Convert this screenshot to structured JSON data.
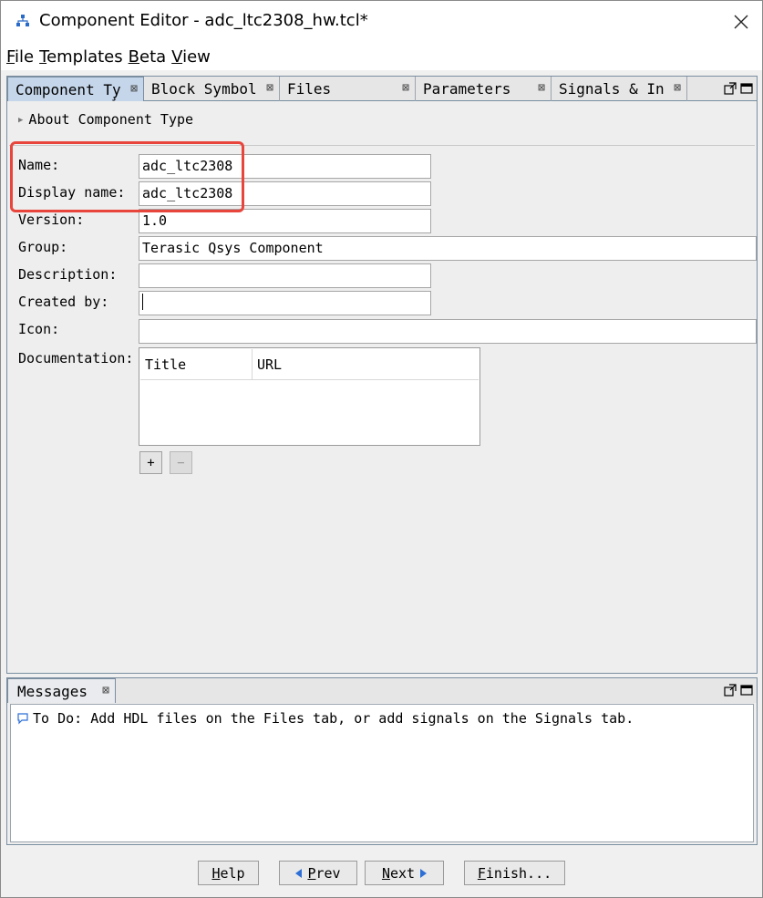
{
  "window": {
    "title": "Component Editor - adc_ltc2308_hw.tcl*",
    "icon": "component-editor-icon",
    "close_icon": "close-icon"
  },
  "menu": [
    {
      "first": "F",
      "rest": "ile"
    },
    {
      "first": "T",
      "rest": "emplates"
    },
    {
      "first": "B",
      "rest": "eta"
    },
    {
      "first": "V",
      "rest": "iew"
    }
  ],
  "tabs": [
    {
      "label": "Component Ty̧",
      "active": true
    },
    {
      "label": "Block Symbol",
      "active": false
    },
    {
      "label": "Files",
      "active": false
    },
    {
      "label": "Parameters",
      "active": false
    },
    {
      "label": "Signals & In",
      "active": false
    }
  ],
  "about": "About Component Type",
  "form": {
    "name_label": "Name:",
    "name_value": "adc_ltc2308",
    "display_label": "Display name:",
    "display_value": "adc_ltc2308",
    "version_label": "Version:",
    "version_value": "1.0",
    "group_label": "Group:",
    "group_value": "Terasic Qsys Component",
    "description_label": "Description:",
    "description_value": "",
    "created_label": "Created by:",
    "created_value": "",
    "icon_label": "Icon:",
    "icon_value": "",
    "documentation_label": "Documentation:"
  },
  "doc_table": {
    "columns": [
      "Title",
      "URL"
    ]
  },
  "doc_buttons": {
    "add": "+",
    "remove": "−"
  },
  "messages": {
    "tab_label": "Messages",
    "line": "To Do: Add HDL files on the Files tab, or add signals on the Signals tab."
  },
  "buttons": {
    "help": {
      "first": "H",
      "rest": "elp"
    },
    "prev": {
      "first": "P",
      "rest": "rev"
    },
    "next": {
      "first": "N",
      "rest": "ext"
    },
    "finish": {
      "first": "F",
      "rest": "inish..."
    }
  },
  "colors": {
    "highlight": "#e8453c",
    "active_tab": "#c5d6ea",
    "arrow_blue": "#2e6fd6"
  }
}
